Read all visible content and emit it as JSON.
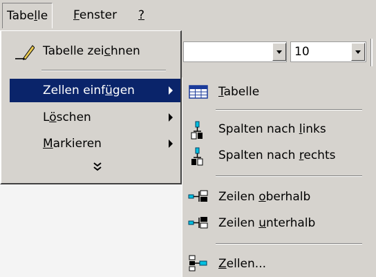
{
  "menubar": {
    "tabelle": {
      "pre": "Tabe",
      "accel": "l",
      "post": "le"
    },
    "fenster": {
      "pre": "",
      "accel": "F",
      "post": "enster"
    },
    "help": {
      "pre": "",
      "accel": "?",
      "post": ""
    }
  },
  "toolbar": {
    "font_size": "10"
  },
  "tabelle_menu": {
    "draw": {
      "pre": "Tabelle zei",
      "accel": "c",
      "post": "hnen"
    },
    "insert": {
      "pre": "Zellen einf",
      "accel": "ü",
      "post": "gen"
    },
    "delete": {
      "pre": "L",
      "accel": "ö",
      "post": "schen"
    },
    "select": {
      "pre": "",
      "accel": "M",
      "post": "arkieren"
    },
    "expand": "»"
  },
  "insert_submenu": {
    "table": {
      "pre": "",
      "accel": "T",
      "post": "abelle"
    },
    "cols_left": {
      "pre": "Spalten nach ",
      "accel": "l",
      "post": "inks"
    },
    "cols_right": {
      "pre": "Spalten nach ",
      "accel": "r",
      "post": "echts"
    },
    "rows_above": {
      "pre": "Zeilen ",
      "accel": "o",
      "post": "berhalb"
    },
    "rows_below": {
      "pre": "Zeilen ",
      "accel": "u",
      "post": "nterhalb"
    },
    "cells": {
      "pre": "",
      "accel": "Z",
      "post": "ellen..."
    }
  },
  "colors": {
    "menu_bg": "#d6d3ce",
    "highlight": "#0a246a",
    "icon_cyan": "#00c0e0"
  },
  "icons": {
    "draw": "pencil-icon",
    "table": "table-grid-icon",
    "cols_left": "insert-columns-left-icon",
    "cols_right": "insert-columns-right-icon",
    "rows_above": "insert-rows-above-icon",
    "rows_below": "insert-rows-below-icon",
    "cells": "insert-cells-icon",
    "expand": "expand-chevrons-icon"
  }
}
